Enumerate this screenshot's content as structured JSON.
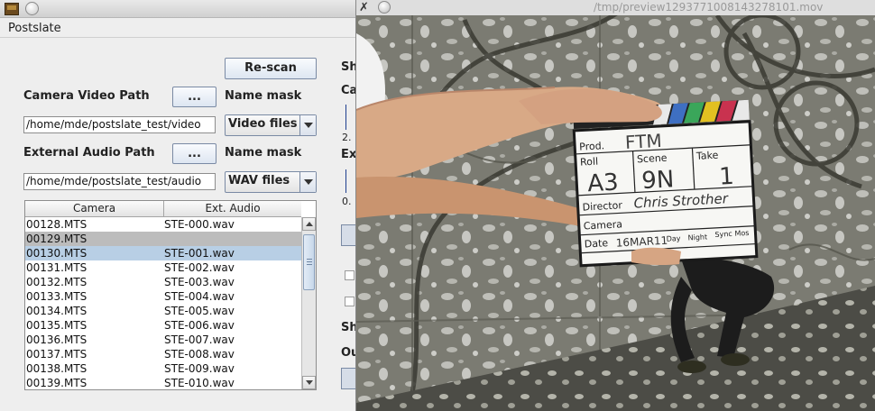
{
  "app": {
    "title": "",
    "menu": [
      "Postslate"
    ],
    "rescan_label": "Re-scan",
    "camera_path_label": "Camera Video Path",
    "browse_label": "...",
    "name_mask_label": "Name mask",
    "camera_path_value": "/home/mde/postslate_test/video",
    "camera_mask_value": "Video files",
    "audio_path_label": "External Audio Path",
    "audio_path_value": "/home/mde/postslate_test/audio",
    "audio_mask_value": "WAV files",
    "table": {
      "columns": [
        "Camera",
        "Ext. Audio"
      ],
      "rows": [
        {
          "camera": "00128.MTS",
          "audio": "STE-000.wav"
        },
        {
          "camera": "00129.MTS",
          "audio": ""
        },
        {
          "camera": "00130.MTS",
          "audio": "STE-001.wav"
        },
        {
          "camera": "00131.MTS",
          "audio": "STE-002.wav"
        },
        {
          "camera": "00132.MTS",
          "audio": "STE-003.wav"
        },
        {
          "camera": "00133.MTS",
          "audio": "STE-004.wav"
        },
        {
          "camera": "00134.MTS",
          "audio": "STE-005.wav"
        },
        {
          "camera": "00135.MTS",
          "audio": "STE-006.wav"
        },
        {
          "camera": "00136.MTS",
          "audio": "STE-007.wav"
        },
        {
          "camera": "00137.MTS",
          "audio": "STE-008.wav"
        },
        {
          "camera": "00138.MTS",
          "audio": "STE-009.wav"
        },
        {
          "camera": "00139.MTS",
          "audio": "STE-010.wav"
        }
      ]
    },
    "right_fragments": [
      "Sh",
      "Ca",
      "2.",
      "Ex",
      "0.",
      "Sh",
      "Ou"
    ]
  },
  "preview": {
    "title": "/tmp/preview1293771008143278101.mov",
    "close_glyph": "✗",
    "slate": {
      "prod_label": "Prod.",
      "prod_value": "FTM",
      "roll_label": "Roll",
      "roll_value": "A3",
      "scene_label": "Scene",
      "scene_value": "9N",
      "take_label": "Take",
      "take_value": "1",
      "director_label": "Director",
      "director_value": "Chris Strother",
      "camera_label": "Camera",
      "date_label": "Date",
      "date_value": "16MAR11",
      "day_label": "Day",
      "night_label": "Night",
      "sync_label": "Sync",
      "mos_label": "Mos"
    }
  },
  "colors": {
    "selected_blue": "#b8cfe5",
    "selected_grey": "#bcbcbc",
    "button_border": "#7a8aa4"
  }
}
